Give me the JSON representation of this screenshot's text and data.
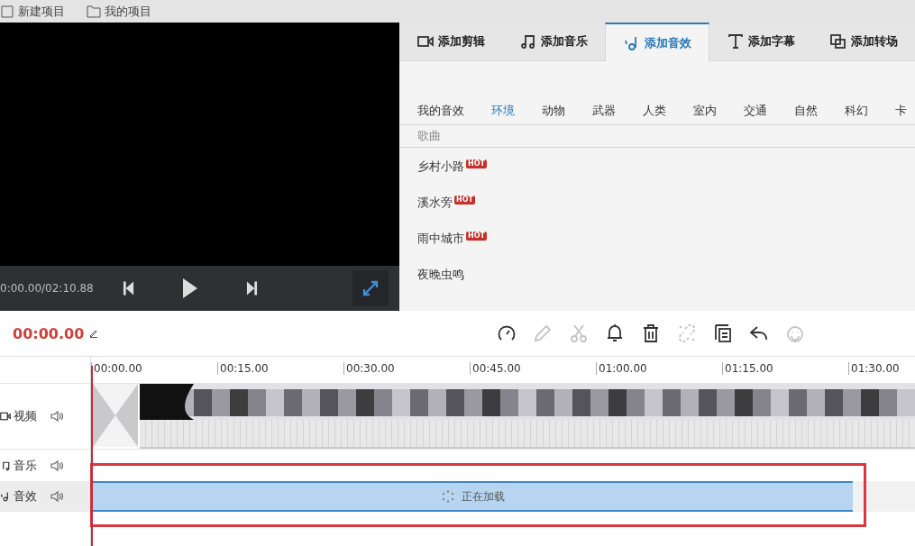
{
  "menu": [
    {
      "kind": "new",
      "label": "新建项目"
    },
    {
      "kind": "folder",
      "label": "我的项目"
    }
  ],
  "player": {
    "time": "0:00.00/02:10.88"
  },
  "tabs": [
    {
      "kind": "clip",
      "label": "添加剪辑",
      "selected": false
    },
    {
      "kind": "music",
      "label": "添加音乐",
      "selected": false
    },
    {
      "kind": "sound",
      "label": "添加音效",
      "selected": true
    },
    {
      "kind": "text",
      "label": "添加字幕",
      "selected": false
    },
    {
      "kind": "transition",
      "label": "添加转场",
      "selected": false
    }
  ],
  "categories": [
    {
      "label": "我的音效",
      "selected": false
    },
    {
      "label": "环境",
      "selected": true
    },
    {
      "label": "动物",
      "selected": false
    },
    {
      "label": "武器",
      "selected": false
    },
    {
      "label": "人类",
      "selected": false
    },
    {
      "label": "室内",
      "selected": false
    },
    {
      "label": "交通",
      "selected": false
    },
    {
      "label": "自然",
      "selected": false
    },
    {
      "label": "科幻",
      "selected": false
    },
    {
      "label": "卡",
      "selected": false
    }
  ],
  "list_header": "歌曲",
  "sounds": [
    {
      "name": "乡村小路",
      "badge": "HOT"
    },
    {
      "name": "溪水旁",
      "badge": "HOT"
    },
    {
      "name": "雨中城市",
      "badge": "HOT"
    },
    {
      "name": "夜晚虫鸣"
    }
  ],
  "timeline": {
    "current_time": "00:00.00",
    "tools": [
      {
        "kind": "speed",
        "disabled": false
      },
      {
        "kind": "pencil",
        "disabled": true
      },
      {
        "kind": "scissors",
        "disabled": true
      },
      {
        "kind": "bell",
        "disabled": false
      },
      {
        "kind": "trash",
        "disabled": false
      },
      {
        "kind": "unlink",
        "disabled": true
      },
      {
        "kind": "copy",
        "disabled": false
      },
      {
        "kind": "undo",
        "disabled": false
      },
      {
        "kind": "smiley",
        "disabled": true
      }
    ],
    "ticks": [
      "00:00.00",
      "00:15.00",
      "00:30.00",
      "00:45.00",
      "01:00.00",
      "01:15.00",
      "01:30.00"
    ],
    "tracks": [
      {
        "kind": "video",
        "name": "视频",
        "selected": false
      },
      {
        "kind": "music",
        "name": "音乐",
        "selected": false
      },
      {
        "kind": "sound",
        "name": "音效",
        "selected": true
      }
    ],
    "loading_text": "正在加载"
  }
}
